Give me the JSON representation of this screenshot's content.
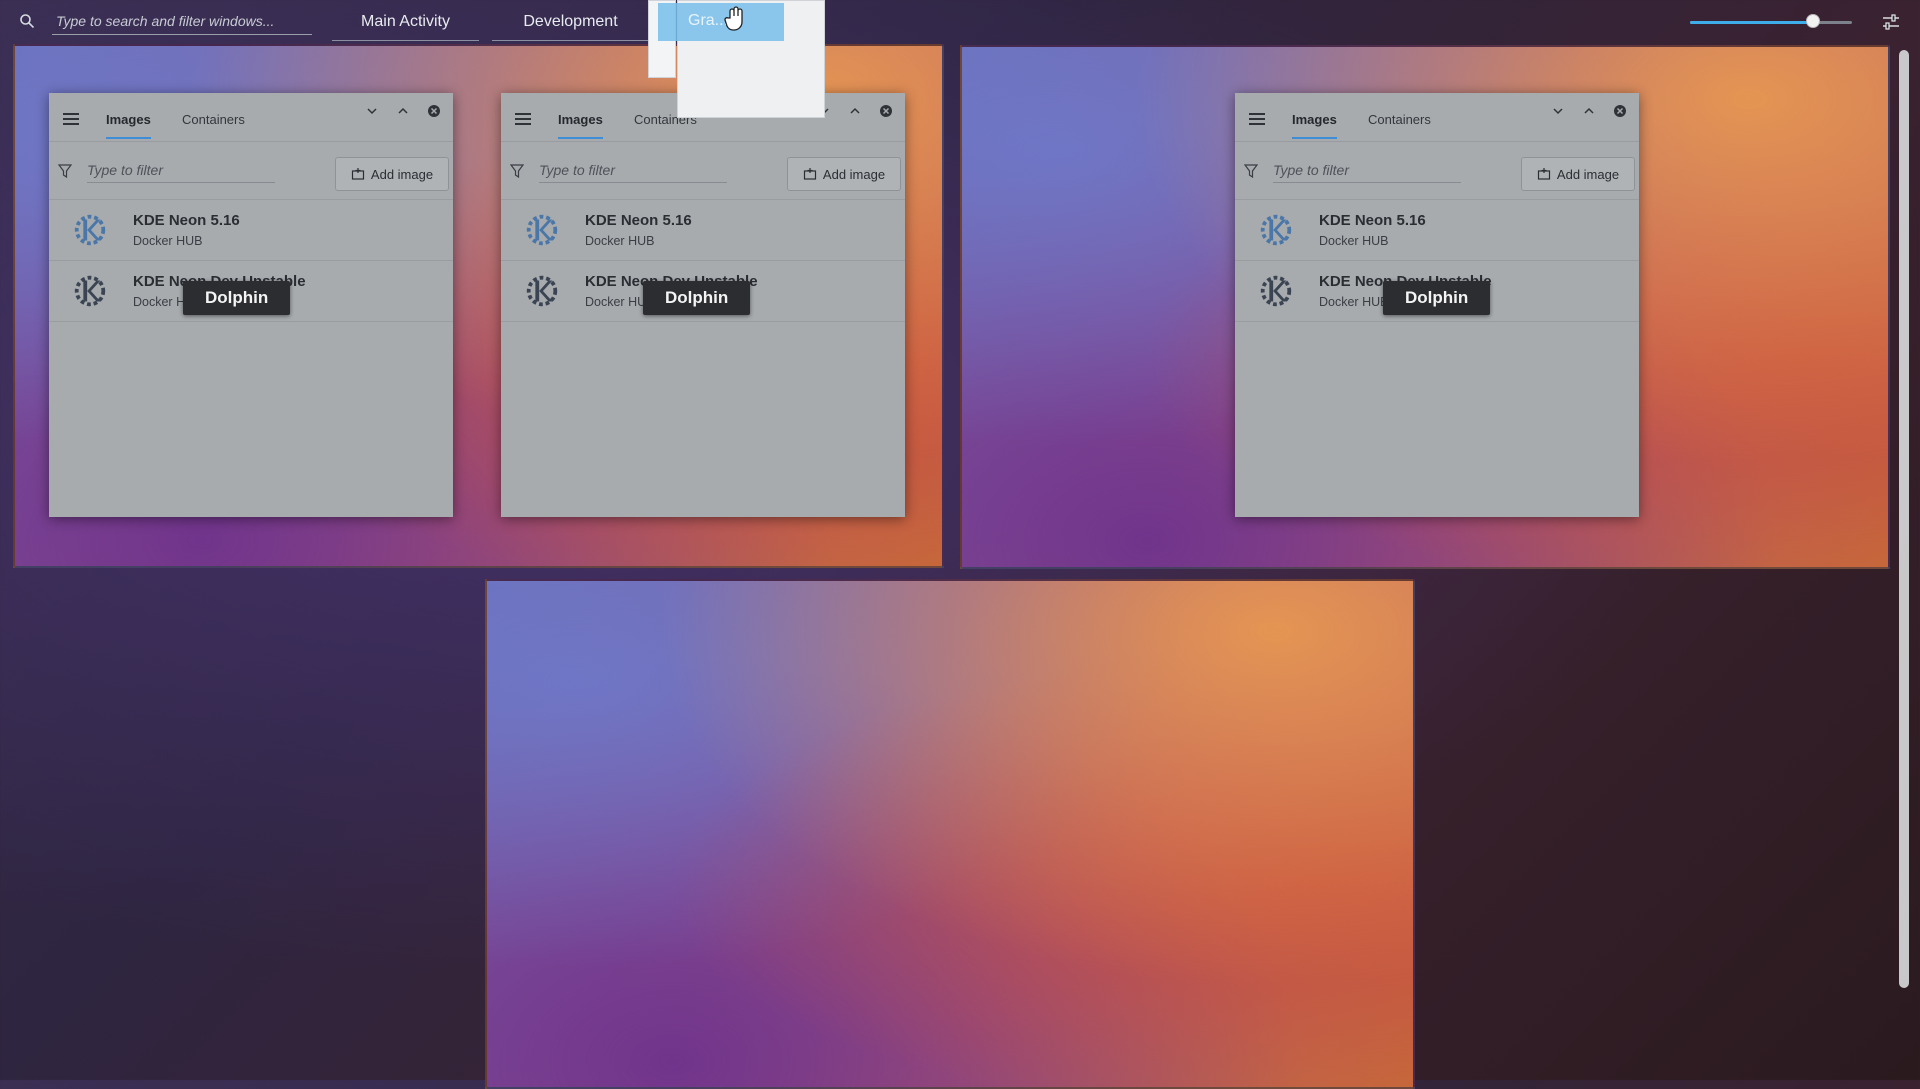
{
  "topbar": {
    "search_placeholder": "Type to search and filter windows...",
    "activities": [
      "Main Activity",
      "Development"
    ],
    "icon_slider_value": 0.76,
    "settings_icon": "settings-sliders-icon"
  },
  "app_window": {
    "tabs": [
      "Images",
      "Containers"
    ],
    "active_tab": "Images",
    "filter_placeholder": "Type to filter",
    "add_image_label": "Add image",
    "items": [
      {
        "title": "KDE Neon 5.16",
        "subtitle": "Docker HUB"
      },
      {
        "title": "KDE Neon Dev Unstable",
        "subtitle": "Docker HUB"
      }
    ],
    "app_label": "Dolphin"
  },
  "drag_preview": {
    "label": "Gra..."
  },
  "colors": {
    "accent": "#3daee9",
    "tab_underline": "#3d8ed6",
    "label_bg": "#2b2d30"
  }
}
